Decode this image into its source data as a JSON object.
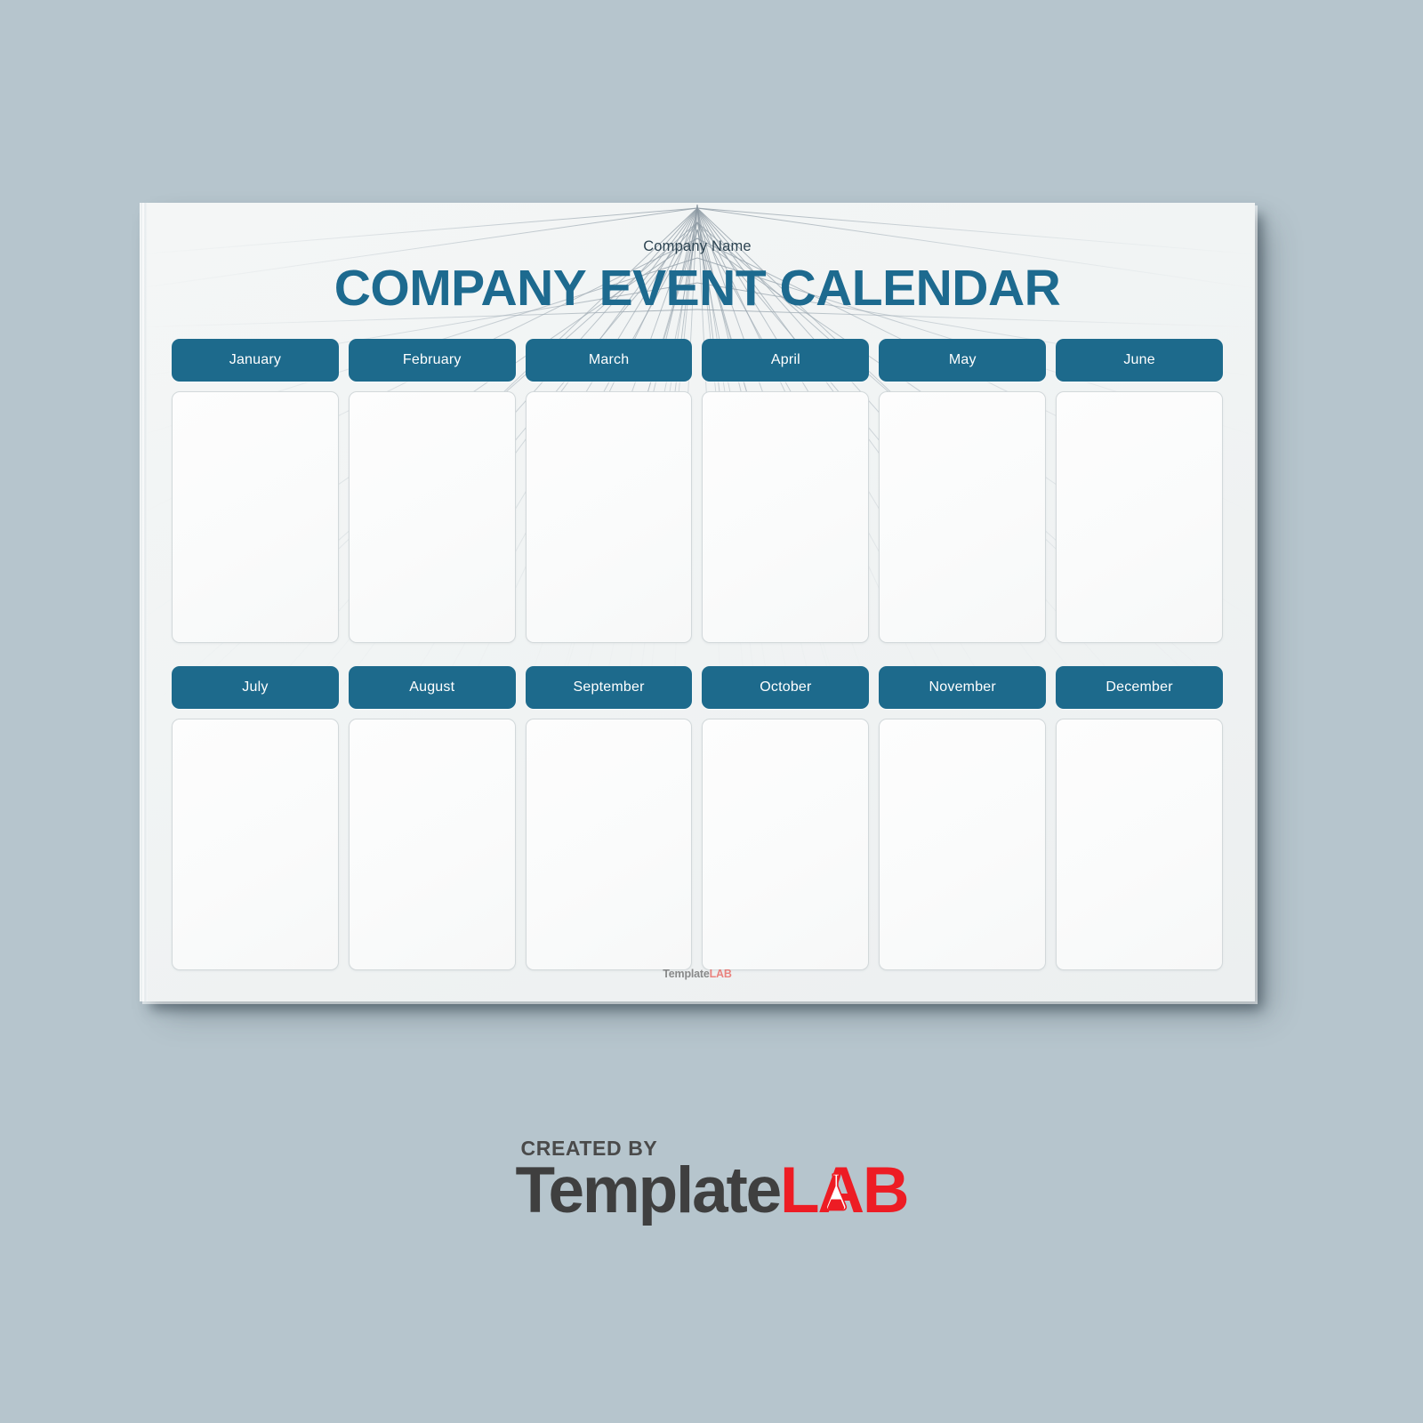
{
  "document": {
    "company_name": "Company Name",
    "title": "COMPANY EVENT CALENDAR",
    "footer_logo": {
      "part1": "Template",
      "part2": "LAB"
    }
  },
  "calendar": {
    "rows": [
      {
        "months": [
          {
            "label": "January",
            "cell_value": ""
          },
          {
            "label": "February",
            "cell_value": ""
          },
          {
            "label": "March",
            "cell_value": ""
          },
          {
            "label": "April",
            "cell_value": ""
          },
          {
            "label": "May",
            "cell_value": ""
          },
          {
            "label": "June",
            "cell_value": ""
          }
        ]
      },
      {
        "months": [
          {
            "label": "July",
            "cell_value": ""
          },
          {
            "label": "August",
            "cell_value": ""
          },
          {
            "label": "September",
            "cell_value": ""
          },
          {
            "label": "October",
            "cell_value": ""
          },
          {
            "label": "November",
            "cell_value": ""
          },
          {
            "label": "December",
            "cell_value": ""
          }
        ]
      }
    ]
  },
  "watermark": {
    "created_by": "CREATED BY",
    "brand_part1": "Template",
    "brand_part2": "LAB"
  },
  "colors": {
    "background": "#b6c5cd",
    "accent_teal": "#1d6a8c",
    "title_teal": "#1d6a8f",
    "brand_red": "#ed1c24",
    "brand_dark": "#3f3f3f",
    "sheet": "#f2f4f5",
    "cell_border": "#d2d8da"
  }
}
